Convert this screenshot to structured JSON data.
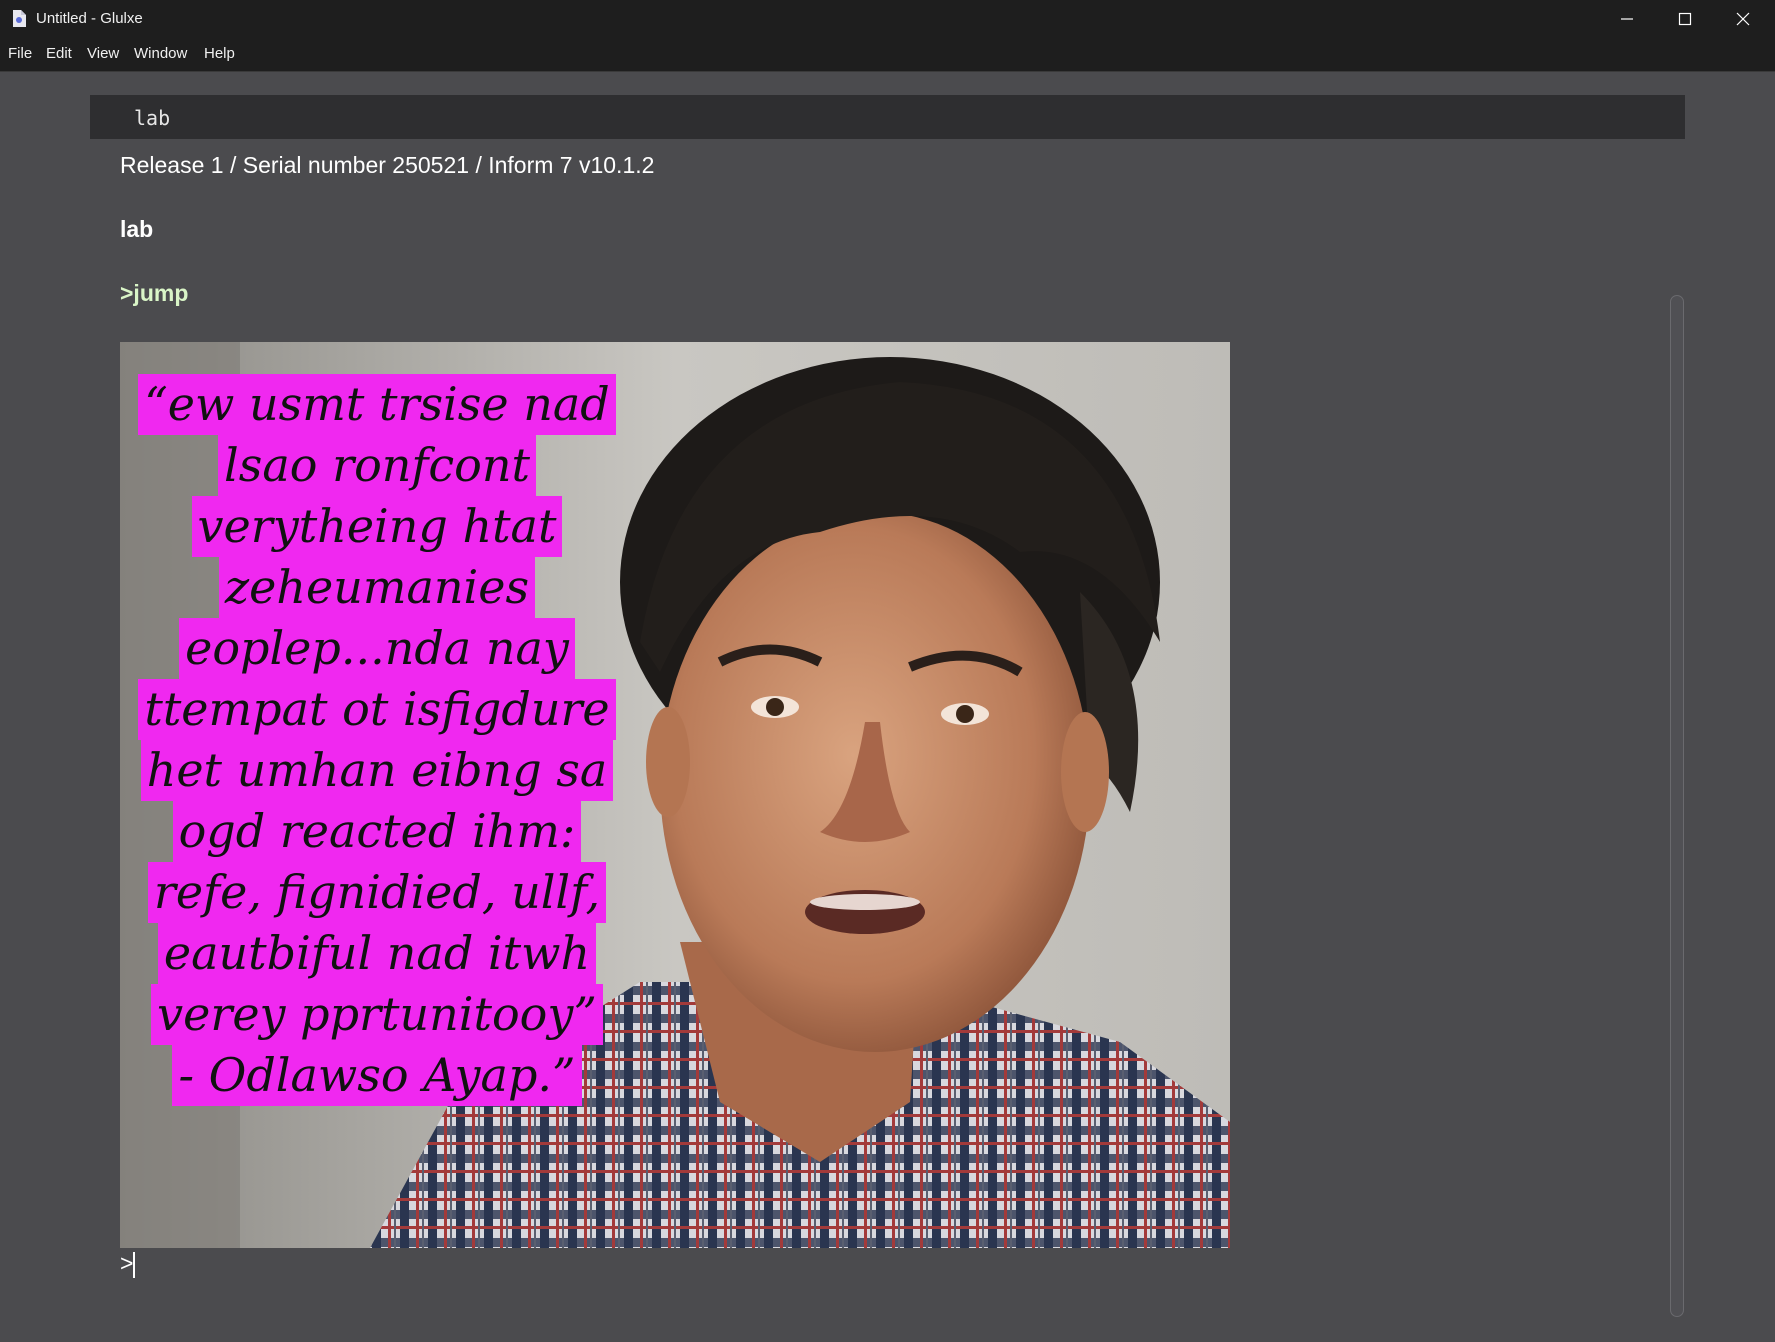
{
  "window": {
    "title": "Untitled - Glulxe",
    "controls": {
      "minimize_icon": "minimize-icon",
      "maximize_icon": "maximize-icon",
      "close_icon": "close-icon"
    }
  },
  "menu": [
    "File",
    "Edit",
    "View",
    "Window",
    "Help"
  ],
  "status_bar": {
    "location": "lab"
  },
  "transcript": {
    "release_line": "Release 1 / Serial number 250521 / Inform 7 v10.1.2",
    "room_name": "lab",
    "command": ">jump",
    "prompt": ">"
  },
  "image": {
    "quote_lines": [
      "“ew usmt trsise nad",
      "lsao ronfcont",
      "verytheing htat",
      "zeheumanies",
      "eoplep...nda nay",
      "ttempat ot isfigdure",
      "het umhan eibng sa",
      "ogd reacted ihm:",
      "refe, fignidied, ullf,",
      "eautbiful nad itwh",
      "verey pprtunitooy”",
      "- Odlawso Ayap.”"
    ],
    "quote_highlight_color": "#f028f0"
  },
  "colors": {
    "background": "#4b4b4e",
    "status_bar": "#2e2e30",
    "command_text": "#d9f5c7",
    "title_bar": "#1e1e1e"
  }
}
